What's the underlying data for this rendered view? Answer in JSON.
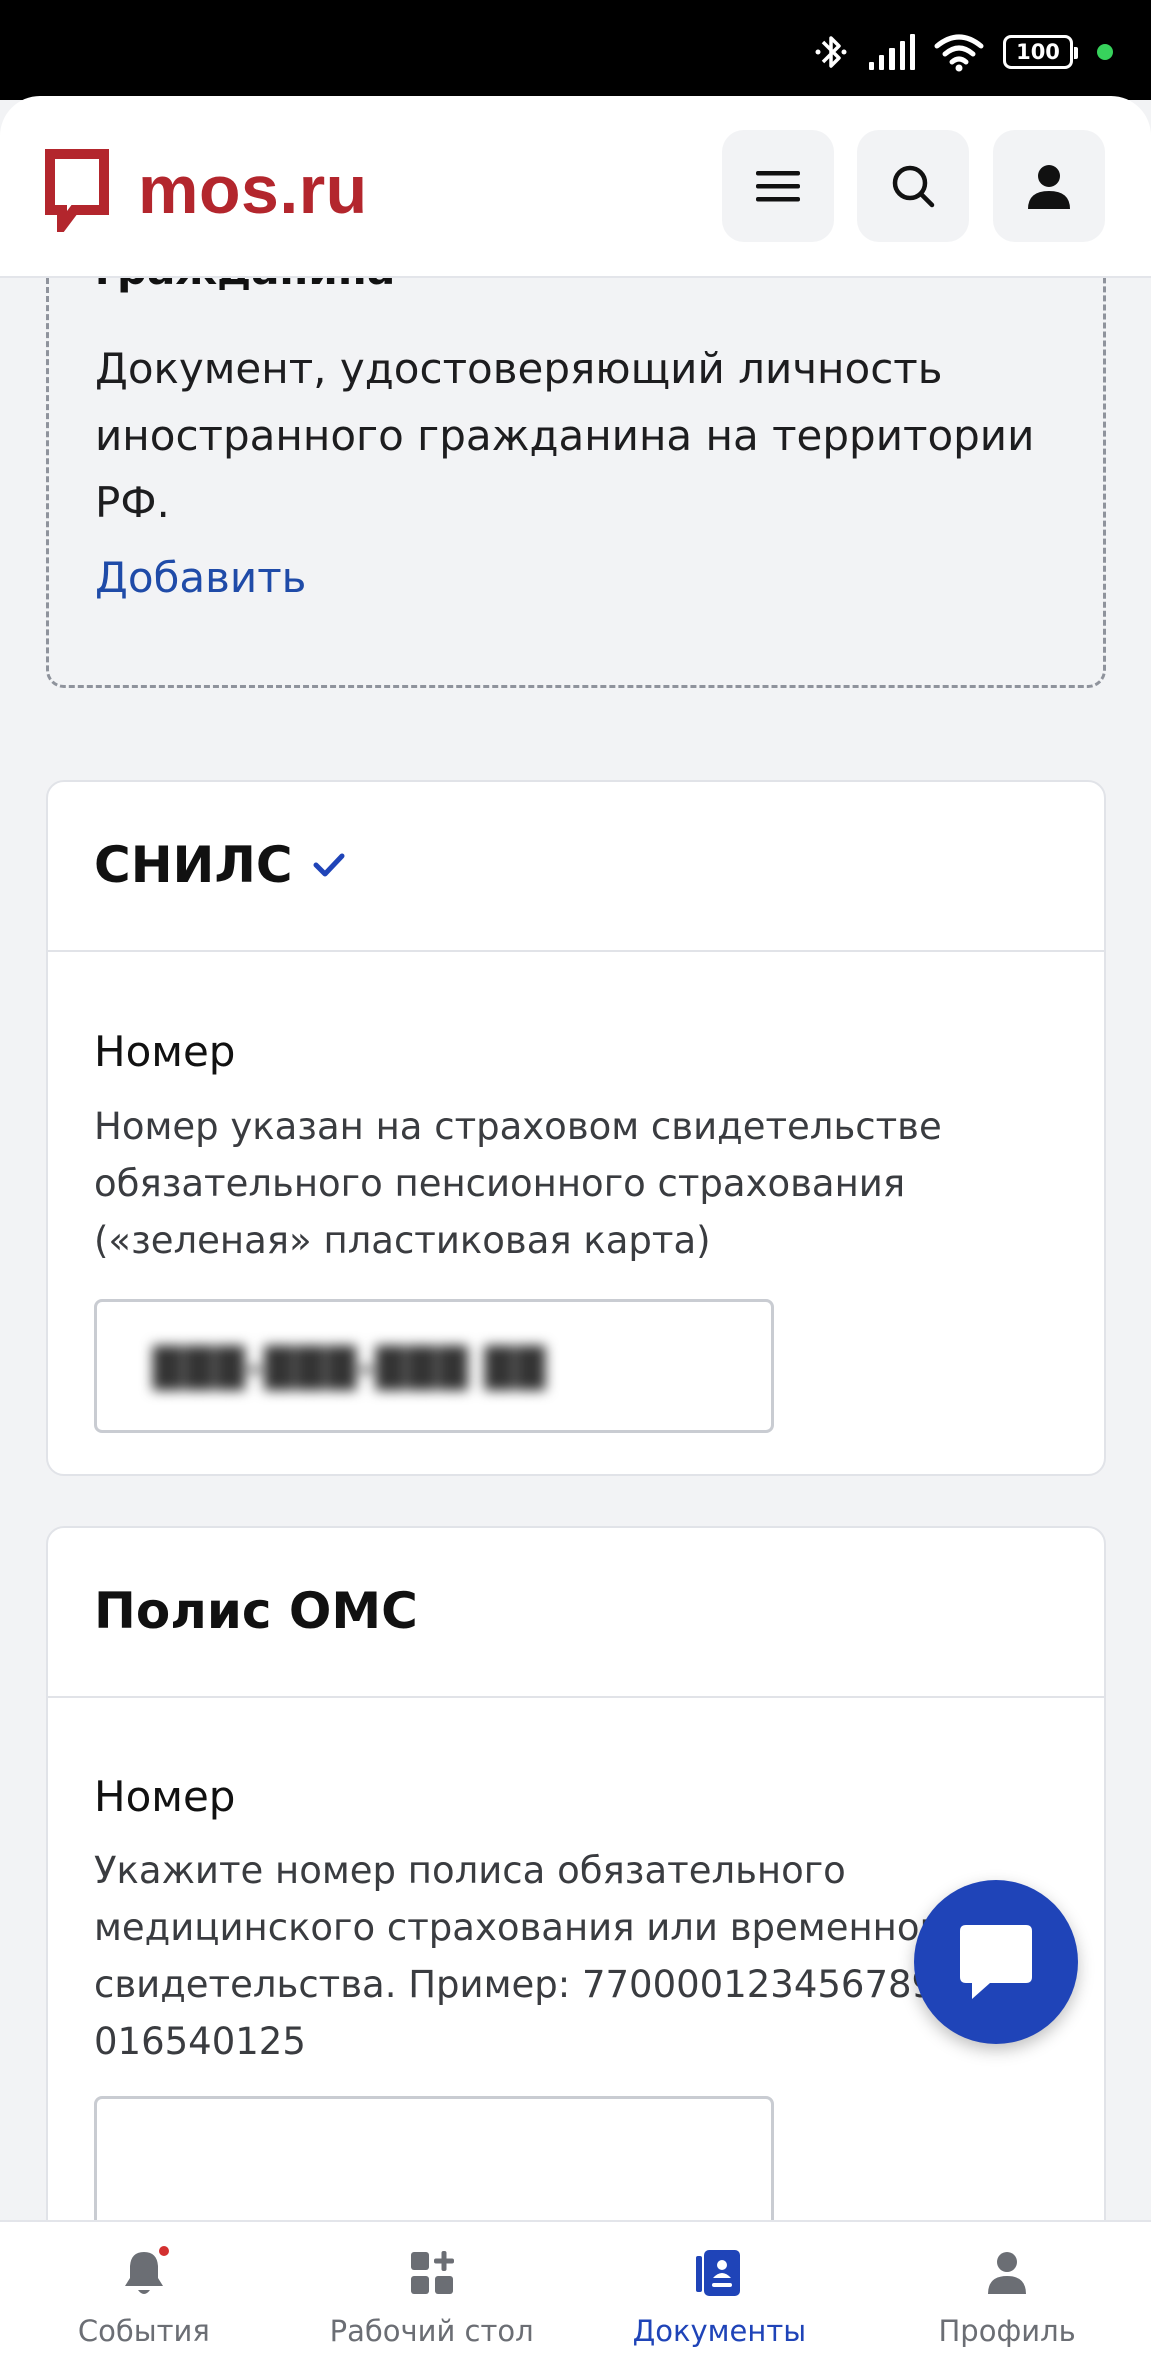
{
  "status_bar": {
    "battery": "100",
    "icons": [
      "bluetooth-icon",
      "signal-icon",
      "wifi-icon",
      "battery-icon"
    ],
    "dot_color": "#37d25c"
  },
  "header": {
    "logo_text": "mos.ru",
    "brand_color": "#b3262d",
    "buttons": [
      "menu-icon",
      "search-icon",
      "user-icon"
    ]
  },
  "card_foreign_id": {
    "title": "гражданина",
    "description": "Документ, удостоверяющий личность иностранного гражданина на территории РФ.",
    "add_link": "Добавить"
  },
  "card_snils": {
    "title": "СНИЛС",
    "verified": true,
    "field_label": "Номер",
    "field_hint": "Номер указан на страховом свидетельстве обязательного пенсионного страхования («зеленая» пластиковая карта)",
    "field_value": "███-███-███ ██"
  },
  "card_oms": {
    "title": "Полис ОМС",
    "field_label": "Номер",
    "field_hint": "Укажите номер полиса обязательного медицинского страхования или временного свидетельства. Пример: 7700001234567890 или 016540125",
    "field_value": ""
  },
  "bottom_nav": [
    {
      "label": "События",
      "icon": "bell-icon",
      "badge": true,
      "active": false
    },
    {
      "label": "Рабочий стол",
      "icon": "dashboard-icon",
      "badge": false,
      "active": false
    },
    {
      "label": "Документы",
      "icon": "documents-icon",
      "badge": false,
      "active": true
    },
    {
      "label": "Профиль",
      "icon": "profile-icon",
      "badge": false,
      "active": false
    }
  ],
  "accent_color": "#1f44b8"
}
